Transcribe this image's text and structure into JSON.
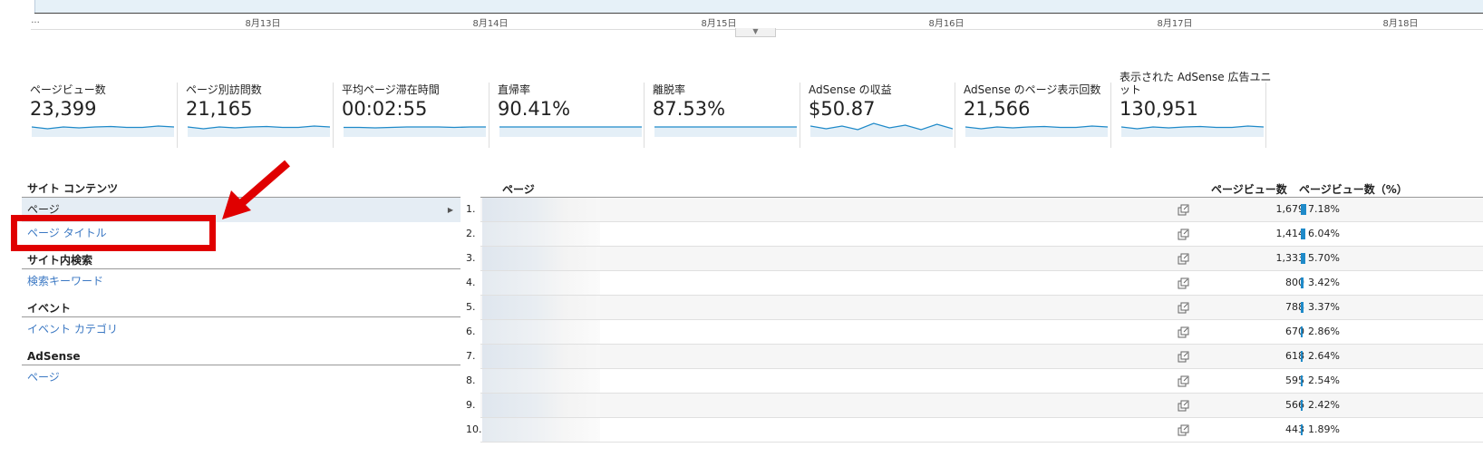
{
  "timeline": {
    "ticks": [
      "...",
      "8月13日",
      "8月14日",
      "8月15日",
      "8月16日",
      "8月17日",
      "8月18日"
    ]
  },
  "metrics": [
    {
      "label": "ページビュー数",
      "value": "23,399",
      "spark": [
        0.5,
        0.3,
        0.5,
        0.4,
        0.5,
        0.55,
        0.45,
        0.45,
        0.6,
        0.5
      ]
    },
    {
      "label": "ページ別訪問数",
      "value": "21,165",
      "spark": [
        0.5,
        0.3,
        0.5,
        0.4,
        0.5,
        0.55,
        0.45,
        0.45,
        0.6,
        0.5
      ]
    },
    {
      "label": "平均ページ滞在時間",
      "value": "00:02:55",
      "spark": [
        0.45,
        0.45,
        0.4,
        0.45,
        0.5,
        0.5,
        0.5,
        0.45,
        0.5,
        0.5
      ]
    },
    {
      "label": "直帰率",
      "value": "90.41%",
      "spark": [
        0.5,
        0.5,
        0.5,
        0.5,
        0.5,
        0.5,
        0.5,
        0.5,
        0.5,
        0.5
      ]
    },
    {
      "label": "離脱率",
      "value": "87.53%",
      "spark": [
        0.5,
        0.5,
        0.5,
        0.5,
        0.5,
        0.5,
        0.5,
        0.5,
        0.5,
        0.5
      ]
    },
    {
      "label": "AdSense の収益",
      "value": "$50.87",
      "spark": [
        0.6,
        0.3,
        0.6,
        0.2,
        0.9,
        0.4,
        0.7,
        0.2,
        0.8,
        0.3
      ]
    },
    {
      "label": "AdSense のページ表示回数",
      "value": "21,566",
      "spark": [
        0.5,
        0.3,
        0.5,
        0.4,
        0.5,
        0.55,
        0.45,
        0.45,
        0.6,
        0.5
      ]
    },
    {
      "label": "表示された AdSense 広告ユニット",
      "label_line2": "ット",
      "label_line1": "表示された AdSense 広告ユニ",
      "value": "130,951",
      "spark": [
        0.5,
        0.3,
        0.5,
        0.4,
        0.5,
        0.55,
        0.45,
        0.45,
        0.6,
        0.5
      ]
    }
  ],
  "nav": {
    "site_content_header": "サイト コンテンツ",
    "page_item": "ページ",
    "page_title_item": "ページ タイトル",
    "site_search_header": "サイト内検索",
    "search_keyword_item": "検索キーワード",
    "event_header": "イベント",
    "event_category_item": "イベント カテゴリ",
    "adsense_header": "AdSense",
    "adsense_page_item": "ページ"
  },
  "table": {
    "col_page": "ページ",
    "col_pageviews": "ページビュー数",
    "col_pageviews_pct": "ページビュー数（%）",
    "rows": [
      {
        "num": "1.",
        "pageviews": "1,679",
        "pct": "7.18%",
        "share": 0.0718
      },
      {
        "num": "2.",
        "pageviews": "1,414",
        "pct": "6.04%",
        "share": 0.0604
      },
      {
        "num": "3.",
        "pageviews": "1,333",
        "pct": "5.70%",
        "share": 0.057
      },
      {
        "num": "4.",
        "pageviews": "800",
        "pct": "3.42%",
        "share": 0.0342
      },
      {
        "num": "5.",
        "pageviews": "788",
        "pct": "3.37%",
        "share": 0.0337
      },
      {
        "num": "6.",
        "pageviews": "670",
        "pct": "2.86%",
        "share": 0.0286
      },
      {
        "num": "7.",
        "pageviews": "618",
        "pct": "2.64%",
        "share": 0.0264
      },
      {
        "num": "8.",
        "pageviews": "595",
        "pct": "2.54%",
        "share": 0.0254
      },
      {
        "num": "9.",
        "pageviews": "566",
        "pct": "2.42%",
        "share": 0.0242
      },
      {
        "num": "10.",
        "pageviews": "443",
        "pct": "1.89%",
        "share": 0.0189
      }
    ]
  },
  "colors": {
    "accent": "#1f8ac9",
    "link": "#3b78c3",
    "annotation": "#e00000"
  }
}
